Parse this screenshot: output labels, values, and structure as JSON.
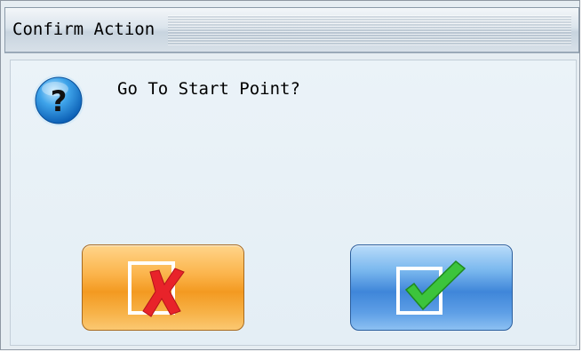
{
  "window": {
    "title": "Confirm Action"
  },
  "dialog": {
    "message": "Go To Start Point?",
    "icon": "question-icon"
  },
  "buttons": {
    "cancel": {
      "icon": "red-x-checkbox-icon",
      "color": "#f39a21"
    },
    "confirm": {
      "icon": "green-check-checkbox-icon",
      "color": "#3f86d9"
    }
  }
}
